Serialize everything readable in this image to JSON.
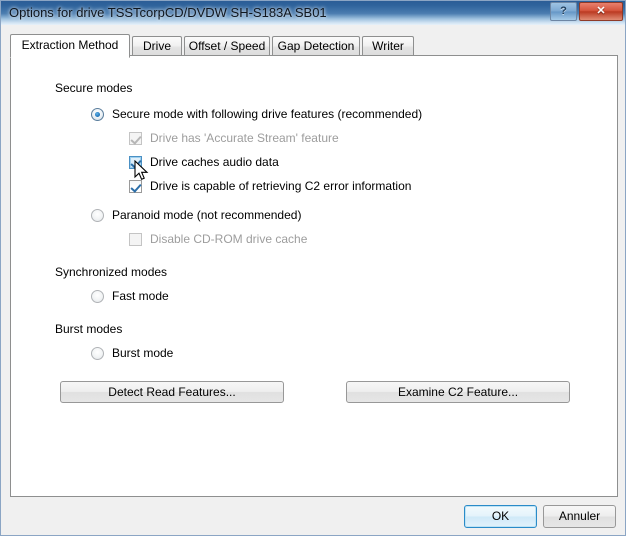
{
  "window": {
    "title": "Options for drive TSSTcorpCD/DVDW SH-S183A SB01",
    "help_button": "?",
    "close_button": "✕"
  },
  "tabs": [
    {
      "label": "Extraction Method",
      "active": true
    },
    {
      "label": "Drive",
      "active": false
    },
    {
      "label": "Offset / Speed",
      "active": false
    },
    {
      "label": "Gap Detection",
      "active": false
    },
    {
      "label": "Writer",
      "active": false
    }
  ],
  "groups": {
    "secure_modes": "Secure modes",
    "synchronized_modes": "Synchronized modes",
    "burst_modes": "Burst modes"
  },
  "options": {
    "secure_mode_radio": "Secure mode with following drive features (recommended)",
    "accurate_stream": "Drive has 'Accurate Stream' feature",
    "caches_audio": "Drive caches audio data",
    "c2_error": "Drive is capable of retrieving C2 error information",
    "paranoid_mode": "Paranoid mode (not recommended)",
    "disable_cache": "Disable CD-ROM drive cache",
    "fast_mode": "Fast mode",
    "burst_mode": "Burst mode"
  },
  "buttons": {
    "detect_read_features": "Detect Read Features...",
    "examine_c2_feature": "Examine C2 Feature...",
    "ok": "OK",
    "cancel": "Annuler"
  },
  "colors": {
    "titlebar_dark": "#2b5d96",
    "titlebar_light": "#e8f1fa",
    "close_red": "#c8432a",
    "accent_blue": "#2277bd",
    "dialog_face": "#f0f0f0",
    "page_white": "#ffffff",
    "disabled_text": "#9d9d9d"
  }
}
